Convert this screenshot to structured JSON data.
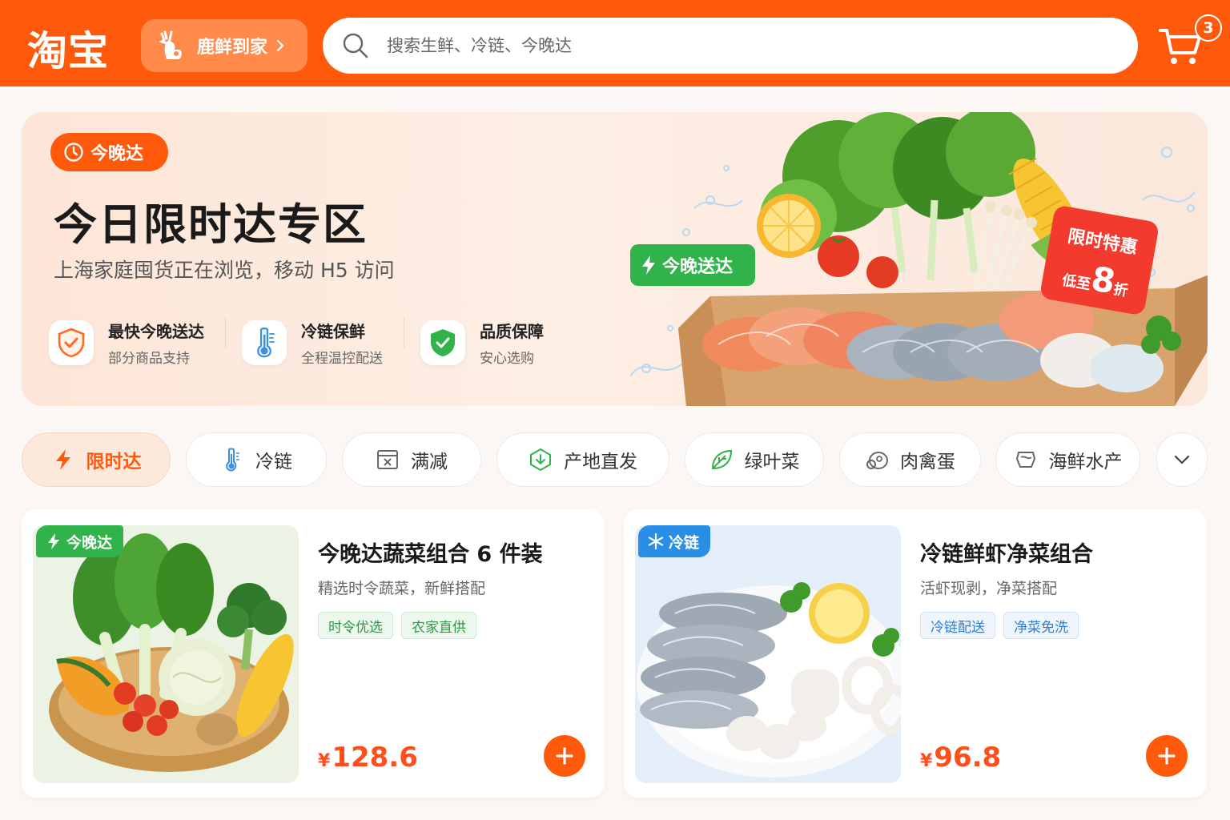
{
  "header": {
    "logo": "淘宝",
    "channel_label": "鹿鲜到家",
    "search_placeholder": "搜索生鲜、冷链、今晚达",
    "cart_count": "3"
  },
  "hero": {
    "tag": "今晚达",
    "title": "今日限时达专区",
    "subtitle": "上海家庭囤货正在浏览，移动 H5 访问",
    "features": [
      {
        "title": "最快今晚送达",
        "desc": "部分商品支持",
        "icon": "shield-check-icon"
      },
      {
        "title": "冷链保鲜",
        "desc": "全程温控配送",
        "icon": "thermometer-icon"
      },
      {
        "title": "品质保障",
        "desc": "安心选购",
        "icon": "quality-shield-icon"
      }
    ],
    "express_badge": "今晚送达",
    "promo": {
      "line1": "限时特惠",
      "line2_prefix": "低至",
      "line2_big": "8",
      "line2_suffix": "折"
    }
  },
  "tabs": [
    {
      "label": "限时达",
      "icon": "lightning-icon",
      "active": true
    },
    {
      "label": "冷链",
      "icon": "thermometer-icon",
      "active": false
    },
    {
      "label": "满减",
      "icon": "coupon-icon",
      "active": false
    },
    {
      "label": "产地直发",
      "icon": "origin-icon",
      "active": false
    },
    {
      "label": "绿叶菜",
      "icon": "leaf-icon",
      "active": false
    },
    {
      "label": "肉禽蛋",
      "icon": "meat-icon",
      "active": false
    },
    {
      "label": "海鲜水产",
      "icon": "seafood-icon",
      "active": false
    }
  ],
  "products": [
    {
      "badge": "今晚达",
      "badge_color": "#2fb34a",
      "title": "今晚达蔬菜组合 6 件装",
      "desc": "精选时令蔬菜，新鲜搭配",
      "tags": [
        "时令优选",
        "农家直供"
      ],
      "price_symbol": "¥",
      "price": "128.6"
    },
    {
      "badge": "冷链",
      "badge_color": "#2b8ee6",
      "title": "冷链鲜虾净菜组合",
      "desc": "活虾现剥，净菜搭配",
      "tags": [
        "冷链配送",
        "净菜免洗"
      ],
      "price_symbol": "¥",
      "price": "96.8"
    }
  ],
  "colors": {
    "brand": "#ff5a0c",
    "green": "#2fb34a",
    "blue": "#2b8ee6",
    "price": "#ff4e1a"
  }
}
